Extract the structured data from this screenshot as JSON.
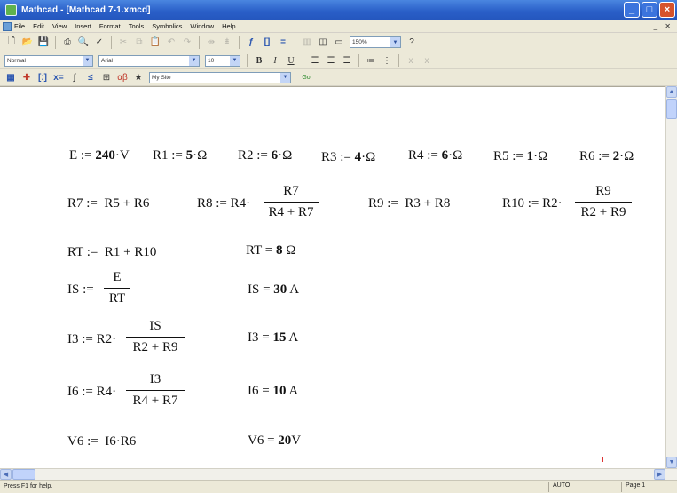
{
  "window": {
    "title": "Mathcad - [Mathcad 7-1.xmcd]",
    "controls": {
      "minimize": "_",
      "maximize": "□",
      "close": "×"
    }
  },
  "menu": {
    "items": [
      "File",
      "Edit",
      "View",
      "Insert",
      "Format",
      "Tools",
      "Symbolics",
      "Window",
      "Help"
    ],
    "mdi_controls": "_ ✕"
  },
  "toolbar": {
    "zoom": "150%",
    "style": "Normal",
    "font": "Arial",
    "font_size": "10",
    "bold": "B",
    "italic": "I",
    "underline": "U",
    "url": "My Site",
    "go": "Go"
  },
  "worksheet": {
    "row1": {
      "e": {
        "name": "E",
        "assign": ":=",
        "value": "240",
        "unit": "V"
      },
      "r1": {
        "name": "R1",
        "assign": ":=",
        "value": "5",
        "unit": "Ω"
      },
      "r2": {
        "name": "R2",
        "assign": ":=",
        "value": "6",
        "unit": "Ω"
      },
      "r3": {
        "name": "R3",
        "assign": ":=",
        "value": "4",
        "unit": "Ω"
      },
      "r4": {
        "name": "R4",
        "assign": ":=",
        "value": "6",
        "unit": "Ω"
      },
      "r5": {
        "name": "R5",
        "assign": ":=",
        "value": "1",
        "unit": "Ω"
      },
      "r6": {
        "name": "R6",
        "assign": ":=",
        "value": "2",
        "unit": "Ω"
      }
    },
    "r7": {
      "lhs": "R7 :=",
      "rhs": "R5 + R6"
    },
    "r8": {
      "lhs": "R8 :=",
      "factor": "R4·",
      "num": "R7",
      "den": "R4 + R7"
    },
    "r9": {
      "lhs": "R9 :=",
      "rhs": "R3 + R8"
    },
    "r10": {
      "lhs": "R10 :=",
      "factor": "R2·",
      "num": "R9",
      "den": "R2 + R9"
    },
    "rt_def": {
      "lhs": "RT :=",
      "rhs": "R1 + R10"
    },
    "rt_res": {
      "lhs": "RT =",
      "value": "8",
      "unit": "Ω"
    },
    "is_def": {
      "lhs": "IS :=",
      "num": "E",
      "den": "RT"
    },
    "is_res": {
      "lhs": "IS =",
      "value": "30",
      "unit": "A"
    },
    "i3_def": {
      "lhs": "I3 :=",
      "factor": "R2·",
      "num": "IS",
      "den": "R2 + R9"
    },
    "i3_res": {
      "lhs": "I3 =",
      "value": "15",
      "unit": "A"
    },
    "i6_def": {
      "lhs": "I6 :=",
      "factor": "R4·",
      "num": "I3",
      "den": "R4 + R7"
    },
    "i6_res": {
      "lhs": "I6 =",
      "value": "10",
      "unit": "A"
    },
    "v6_def": {
      "lhs": "V6 :=",
      "rhs": "I6·R6"
    },
    "v6_res": {
      "lhs": "V6 =",
      "value": "20",
      "unit": "V"
    }
  },
  "status": {
    "text": "Press F1 for help.",
    "mode": "AUTO",
    "page": "Page 1"
  }
}
